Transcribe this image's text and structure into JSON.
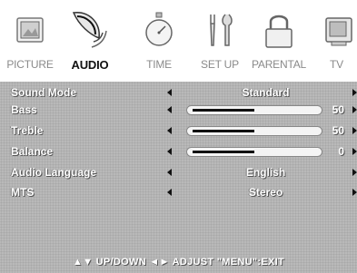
{
  "tabs": [
    {
      "label": "PICTURE",
      "icon": "picture-frame-icon",
      "active": false
    },
    {
      "label": "AUDIO",
      "icon": "speaker-icon",
      "active": true
    },
    {
      "label": "TIME",
      "icon": "stopwatch-icon",
      "active": false
    },
    {
      "label": "SET UP",
      "icon": "tools-icon",
      "active": false
    },
    {
      "label": "PARENTAL",
      "icon": "padlock-icon",
      "active": false
    },
    {
      "label": "TV",
      "icon": "television-icon",
      "active": false
    }
  ],
  "menu": [
    {
      "label": "Sound Mode",
      "value": "Standard"
    },
    {
      "label": "Bass",
      "number": "50",
      "level": 0.5
    },
    {
      "label": "Treble",
      "number": "50",
      "level": 0.5
    },
    {
      "label": "Balance",
      "number": "0",
      "level": 0.5
    },
    {
      "label": "Audio Language",
      "value": "English"
    },
    {
      "label": "MTS",
      "value": "Stereo"
    }
  ],
  "footer": "▲▼ UP/DOWN ◄► ADJUST \"MENU\":EXIT",
  "colors": {
    "panel": "#b9b9b9",
    "active_tab": "#111111",
    "inactive_tab": "#8a8a8a"
  }
}
